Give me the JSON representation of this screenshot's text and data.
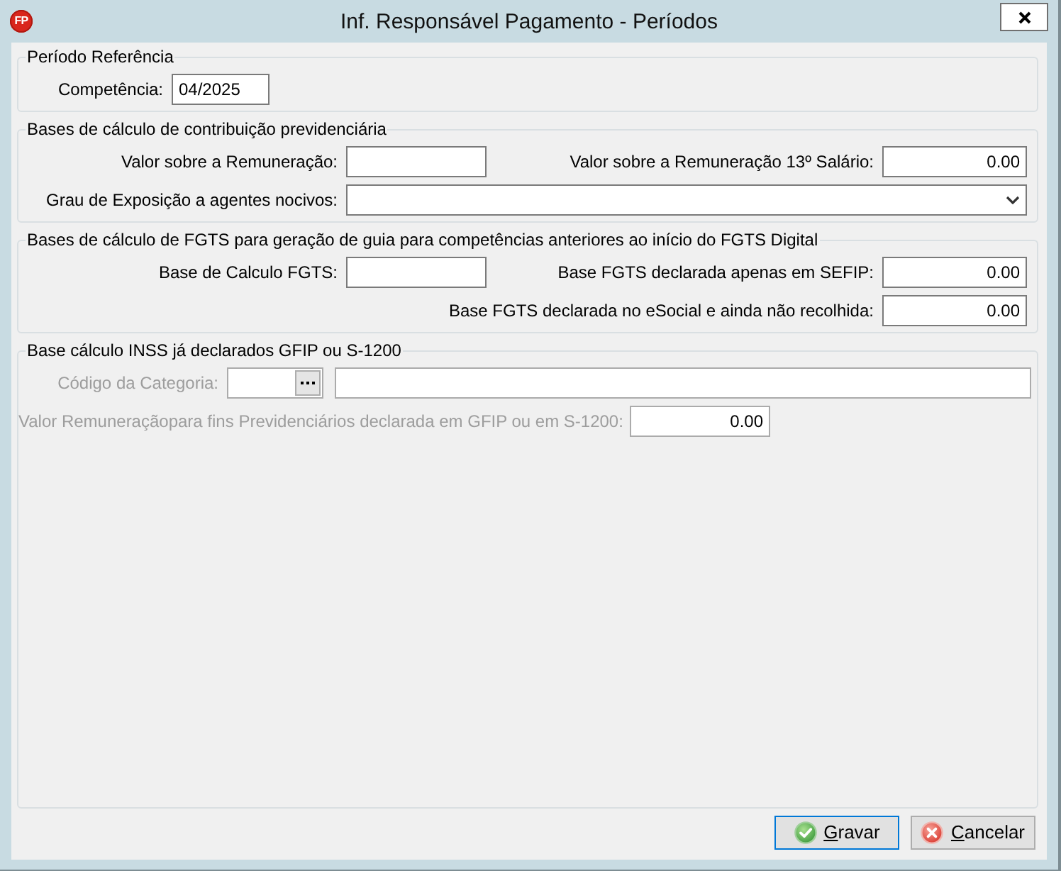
{
  "window": {
    "logo": "FP",
    "title": "Inf. Responsável Pagamento - Períodos"
  },
  "groups": [
    {
      "title": "Período Referência",
      "rows": [
        [
          {
            "label": "Competência:",
            "kind": "text",
            "value": "04/2025",
            "disabled": false
          }
        ]
      ]
    },
    {
      "title": "Bases de cálculo de contribuição previdenciária",
      "rows": [
        [
          {
            "label": "Valor sobre a Remuneração:",
            "kind": "number",
            "disabled": false
          },
          {
            "label": "Valor sobre a Remuneração 13º Salário:",
            "kind": "number",
            "value": "0.00",
            "disabled": false
          }
        ],
        [
          {
            "label": "Grau de Exposição a agentes nocivos:",
            "kind": "select",
            "disabled": false
          }
        ]
      ]
    },
    {
      "title": "Bases de cálculo de FGTS para geração de guia para competências anteriores ao início do FGTS Digital",
      "rows": [
        [
          {
            "label": "Base de Calculo FGTS:",
            "kind": "number",
            "disabled": false
          },
          {
            "label": "Base FGTS declarada apenas em SEFIP:",
            "kind": "number",
            "value": "0.00",
            "disabled": false
          }
        ],
        [
          "",
          {
            "label": "Base FGTS declarada no eSocial e ainda não recolhida:",
            "kind": "number",
            "value": "0.00",
            "disabled": false
          }
        ]
      ]
    },
    {
      "title": "Base cálculo INSS já declarados GFIP ou S-1200",
      "rows": [
        [
          {
            "label": "Código da Categoria:",
            "kind": "lookup",
            "disabled": true
          },
          {
            "kind": "text",
            "disabled": true
          }
        ],
        [
          {
            "label": "Valor Remuneraçãopara fins Previdenciários declarada em GFIP ou em S-1200:",
            "kind": "number",
            "value": "0.00",
            "disabled": true
          }
        ]
      ]
    }
  ],
  "buttons": [
    {
      "label": "Gravar",
      "kind": "save",
      "default": true
    },
    {
      "label": "Cancelar",
      "kind": "cancel",
      "default": false
    }
  ]
}
